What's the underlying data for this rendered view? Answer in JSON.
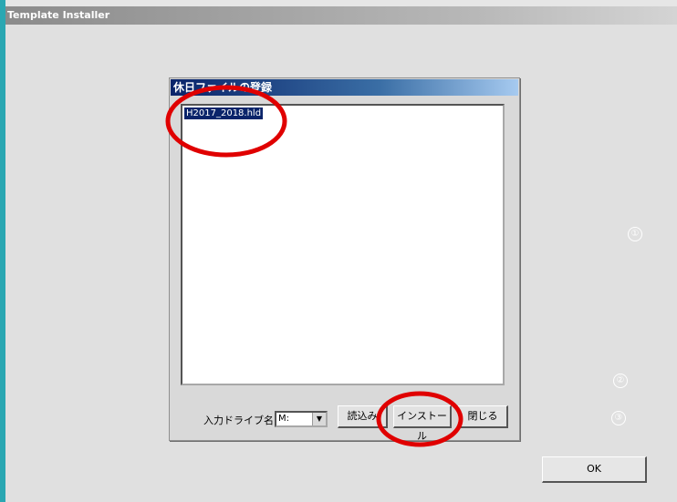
{
  "window": {
    "title": "Template Installer"
  },
  "dialog": {
    "title": "休日ファイルの登録",
    "list_items": [
      "H2017_2018.hld"
    ],
    "drive_label": "入力ドライブ名",
    "drive_value": "M:",
    "read_button": "読込み",
    "install_button": "インストール",
    "close_button": "閉じる"
  },
  "markers": {
    "m1": "①",
    "m2": "②",
    "m3": "③"
  },
  "ok_button": "OK",
  "colors": {
    "annotation_red": "#e00000",
    "title_blue": "#0a246a",
    "left_edge": "#2aa7b2"
  }
}
